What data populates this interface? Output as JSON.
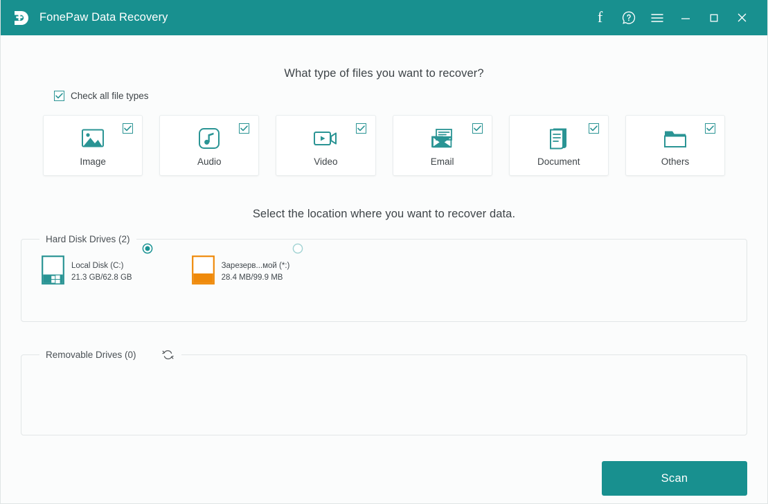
{
  "titlebar": {
    "app_title": "FonePaw Data Recovery",
    "logo_icon": "fonepaw-d-plus-logo",
    "brand_color": "#18908f",
    "buttons": [
      {
        "name": "facebook-button",
        "icon": "facebook-f-icon",
        "glyph": "f"
      },
      {
        "name": "help-button",
        "icon": "help-question-bubble-icon",
        "glyph": "?"
      },
      {
        "name": "menu-button",
        "icon": "hamburger-menu-icon",
        "glyph": "☰"
      },
      {
        "name": "minimize-button",
        "icon": "minimize-icon",
        "glyph": "–"
      },
      {
        "name": "maximize-button",
        "icon": "maximize-icon",
        "glyph": "□"
      },
      {
        "name": "close-button",
        "icon": "close-icon",
        "glyph": "×"
      }
    ]
  },
  "filetypes": {
    "heading": "What type of files you want to recover?",
    "check_all_label": "Check all file types",
    "check_all_checked": true,
    "accent_color": "#2a9494",
    "items": [
      {
        "label": "Image",
        "icon": "image-icon",
        "checked": true
      },
      {
        "label": "Audio",
        "icon": "audio-icon",
        "checked": true
      },
      {
        "label": "Video",
        "icon": "video-icon",
        "checked": true
      },
      {
        "label": "Email",
        "icon": "email-icon",
        "checked": true
      },
      {
        "label": "Document",
        "icon": "document-icon",
        "checked": true
      },
      {
        "label": "Others",
        "icon": "folder-icon",
        "checked": true
      }
    ]
  },
  "location": {
    "heading": "Select the location where you want to recover data.",
    "hard_disk_legend": "Hard Disk Drives (2)",
    "removable_legend": "Removable Drives (0)",
    "refresh_icon": "refresh-icon",
    "hard_disks": [
      {
        "name": "Local Disk (C:)",
        "size": "21.3 GB/62.8 GB",
        "selected": true,
        "icon": "windows-system-drive-icon",
        "color": "#2a9494",
        "fill_percent": 34
      },
      {
        "name": "Зарезерв...мой (*:)",
        "size": "28.4 MB/99.9 MB",
        "selected": false,
        "icon": "drive-icon",
        "color": "#ef8a0b",
        "fill_percent": 38
      }
    ],
    "removable_drives": []
  },
  "footer": {
    "scan_label": "Scan"
  }
}
